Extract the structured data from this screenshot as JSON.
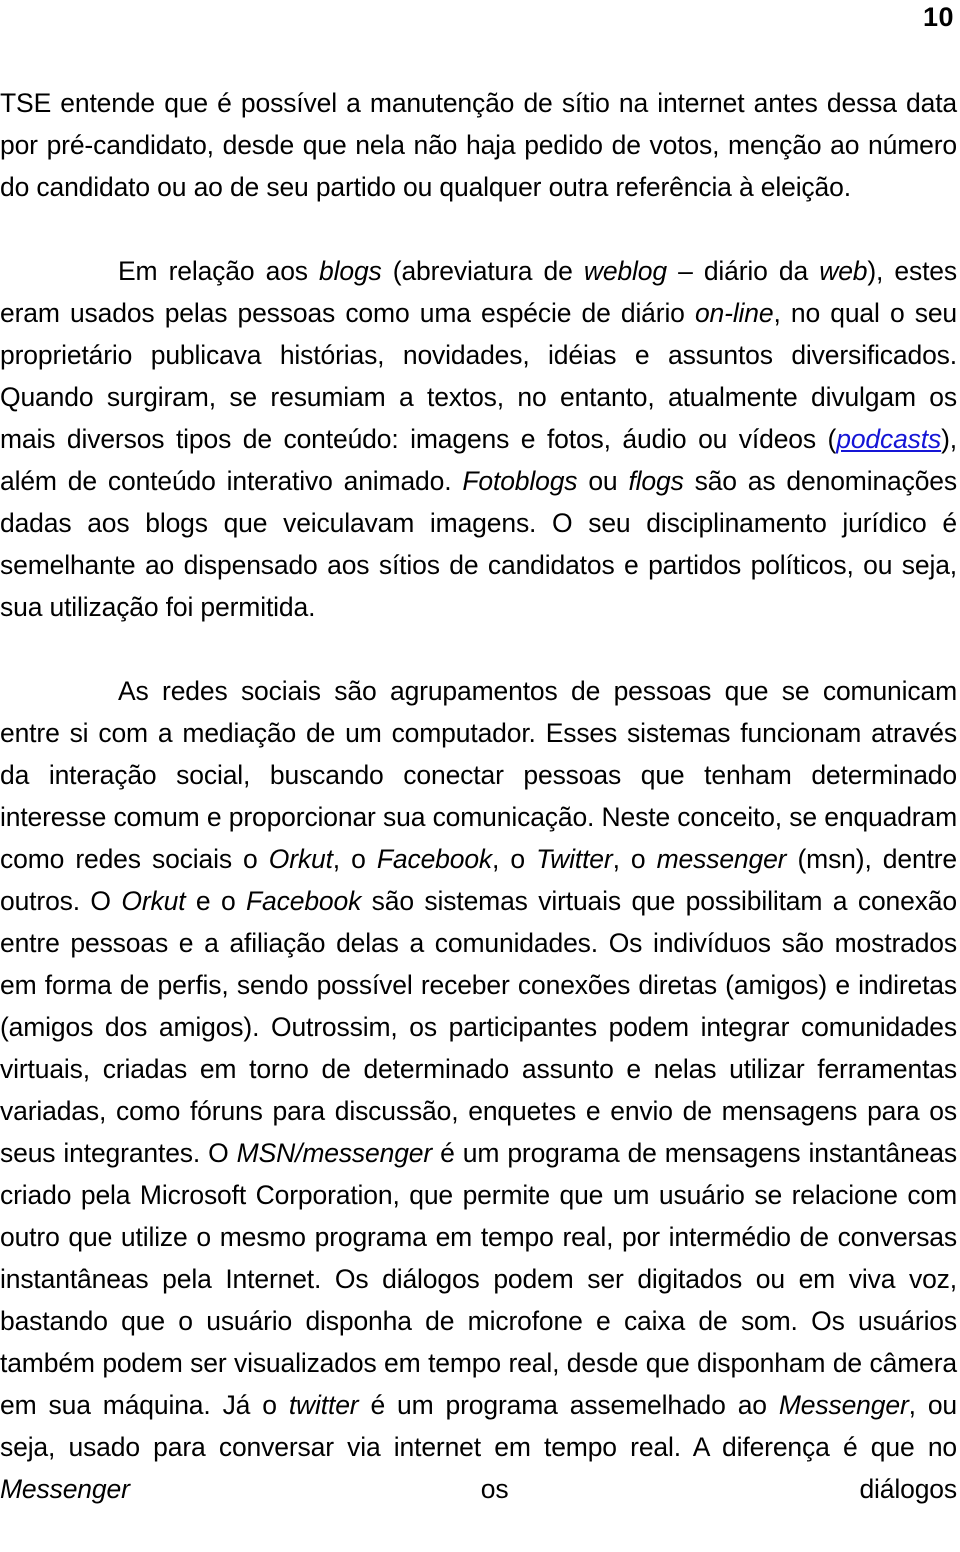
{
  "document": {
    "page_number": "10",
    "language": "pt-BR",
    "link_color": "#1515d6",
    "text_color": "#000000",
    "background_color": "#ffffff"
  },
  "paragraphs": {
    "p1": {
      "runs": [
        {
          "text": "TSE entende que é possível a manutenção de sítio na internet antes dessa data por pré-candidato, desde que nela não haja pedido de votos, menção ao número do candidato ou ao de seu partido ou qualquer outra referência à eleição.",
          "style": "normal"
        }
      ]
    },
    "p2": {
      "runs": [
        {
          "text": "Em relação aos ",
          "style": "normal"
        },
        {
          "text": "blogs",
          "style": "italic"
        },
        {
          "text": " (abreviatura de ",
          "style": "normal"
        },
        {
          "text": "weblog",
          "style": "italic"
        },
        {
          "text": " – diário da ",
          "style": "normal"
        },
        {
          "text": "web",
          "style": "italic"
        },
        {
          "text": "), estes eram usados pelas pessoas como uma espécie de diário ",
          "style": "normal"
        },
        {
          "text": "on-line",
          "style": "italic"
        },
        {
          "text": ", no qual o seu proprietário publicava histórias, novidades, idéias e assuntos diversificados. Quando surgiram, se resumiam a textos, no entanto, atualmente divulgam os mais diversos tipos de conteúdo: imagens e fotos, áudio ou vídeos (",
          "style": "normal"
        },
        {
          "text": "podcasts",
          "style": "link"
        },
        {
          "text": "), além de conteúdo interativo animado. ",
          "style": "normal"
        },
        {
          "text": "Fotoblogs",
          "style": "italic"
        },
        {
          "text": " ou ",
          "style": "normal"
        },
        {
          "text": "flogs",
          "style": "italic"
        },
        {
          "text": " são as denominações dadas aos blogs que veiculavam imagens. O seu disciplinamento jurídico é semelhante ao dispensado aos sítios de candidatos e partidos políticos, ou seja, sua utilização foi permitida.",
          "style": "normal"
        }
      ]
    },
    "p3": {
      "runs": [
        {
          "text": "As redes sociais são agrupamentos de pessoas que se comunicam entre si com a mediação de um computador. Esses sistemas funcionam através da interação social, buscando conectar pessoas que tenham determinado interesse comum e proporcionar sua comunicação. Neste conceito, se enquadram como redes sociais o ",
          "style": "normal"
        },
        {
          "text": "Orkut",
          "style": "italic"
        },
        {
          "text": ", o ",
          "style": "normal"
        },
        {
          "text": "Facebook",
          "style": "italic"
        },
        {
          "text": ", o ",
          "style": "normal"
        },
        {
          "text": "Twitter",
          "style": "italic"
        },
        {
          "text": ", o ",
          "style": "normal"
        },
        {
          "text": "messenger",
          "style": "italic"
        },
        {
          "text": " (msn), dentre outros. O ",
          "style": "normal"
        },
        {
          "text": "Orkut",
          "style": "italic"
        },
        {
          "text": " e o ",
          "style": "normal"
        },
        {
          "text": "Facebook",
          "style": "italic"
        },
        {
          "text": " são sistemas virtuais que possibilitam a conexão entre pessoas e a afiliação delas a comunidades. Os indivíduos são mostrados em forma de perfis, sendo possível receber conexões diretas (amigos) e indiretas (amigos dos amigos). Outrossim, os participantes podem integrar comunidades virtuais, criadas em torno de determinado assunto e nelas utilizar ferramentas variadas, como fóruns para discussão, enquetes e envio de mensagens para os seus integrantes. O ",
          "style": "normal"
        },
        {
          "text": "MSN/messenger",
          "style": "italic"
        },
        {
          "text": " é um programa de mensagens instantâneas criado pela Microsoft Corporation, que permite que um usuário se relacione com outro que utilize o mesmo programa em tempo real, por intermédio de conversas instantâneas pela Internet. Os diálogos podem ser digitados ou em viva voz, bastando que o usuário disponha de microfone e caixa de som. Os usuários também podem ser visualizados em tempo real, desde que disponham de câmera em sua máquina. Já o ",
          "style": "normal"
        },
        {
          "text": "twitter",
          "style": "italic"
        },
        {
          "text": " é um programa assemelhado ao ",
          "style": "normal"
        },
        {
          "text": "Messenger",
          "style": "italic"
        },
        {
          "text": ", ou seja, usado para conversar via internet em tempo real. A diferença é que no ",
          "style": "normal"
        },
        {
          "text": "Messenger",
          "style": "italic"
        },
        {
          "text": " os diálogos",
          "style": "normal"
        }
      ]
    }
  }
}
